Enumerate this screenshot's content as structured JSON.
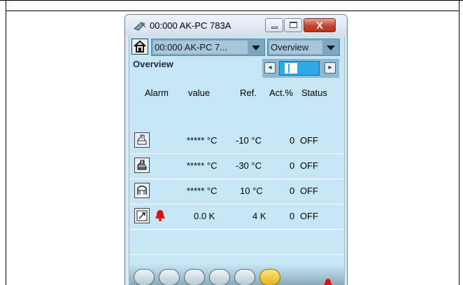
{
  "window": {
    "title": "00:000 AK-PC 783A",
    "close_label": "X"
  },
  "toolbar": {
    "device_select": "00:000 AK-PC 7...",
    "view_select": "Overview",
    "section_label": "Overview"
  },
  "table": {
    "headers": [
      "Alarm",
      "value",
      "Ref.",
      "Act.%",
      "Status"
    ],
    "rows": [
      {
        "icon": "cabinet-cooler-icon",
        "alarm": false,
        "value": "***** °C",
        "ref": "-10 °C",
        "act": "0",
        "status": "OFF"
      },
      {
        "icon": "freezer-cooler-icon",
        "alarm": false,
        "value": "***** °C",
        "ref": "-30 °C",
        "act": "0",
        "status": "OFF"
      },
      {
        "icon": "display-case-icon",
        "alarm": false,
        "value": "***** °C",
        "ref": "10 °C",
        "act": "0",
        "status": "OFF"
      },
      {
        "icon": "condenser-icon",
        "alarm": true,
        "value": "0.0 K",
        "ref": "4 K",
        "act": "0",
        "status": "OFF"
      }
    ]
  },
  "tabs": [
    {
      "name": "evaporators-tab-icon"
    },
    {
      "name": "controller-tab-icon"
    },
    {
      "name": "cycle-tab-icon"
    },
    {
      "name": "graph-tab-icon"
    },
    {
      "name": "alarms-tab-icon"
    },
    {
      "name": "service-tab-icon",
      "active": true
    }
  ],
  "colors": {
    "client_bg": "#c6e6f6",
    "alarm_red": "#e01010",
    "active_tab": "#f2c93a"
  }
}
